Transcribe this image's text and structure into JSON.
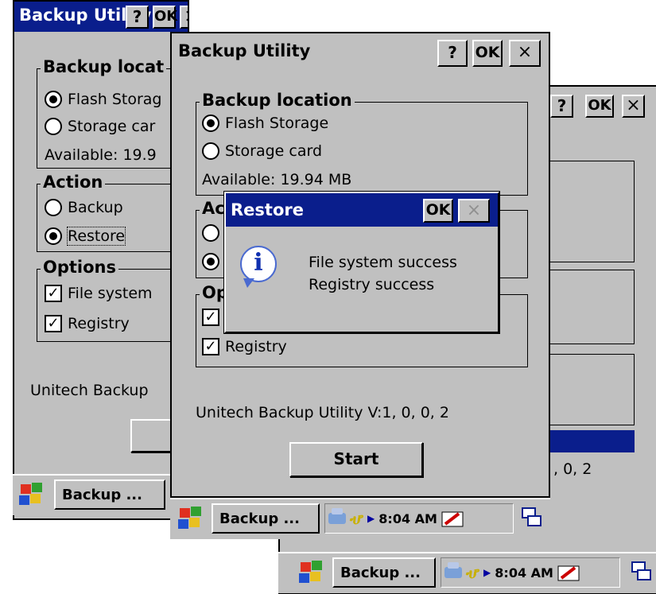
{
  "back_window": {
    "title": "Backup Utility",
    "help_label": "?",
    "ok_label": "OK",
    "close_label": "×",
    "backup_location_legend": "Backup locat",
    "flash_storage": "Flash Storag",
    "storage_card": "Storage car",
    "available": "Available: 19.9",
    "action_legend": "Action",
    "backup": "Backup",
    "restore": "Restore",
    "options_legend": "Options",
    "file_system": "File system",
    "registry": "Registry",
    "version": "Unitech Backup",
    "taskbar_item": "Backup ..."
  },
  "right_window": {
    "help_label": "?",
    "ok_label": "OK",
    "close_label": "×",
    "version_fragment": ", 0, 2",
    "taskbar_item": "Backup ...",
    "clock": "8:04 AM"
  },
  "main_window": {
    "title": "Backup Utility",
    "help_label": "?",
    "ok_label": "OK",
    "close_label": "×",
    "backup_location_legend": "Backup location",
    "flash_storage": "Flash Storage",
    "storage_card": "Storage card",
    "available": "Available: 19.94 MB",
    "action_legend": "Ac",
    "options_legend": "Op",
    "registry": "Registry",
    "version": "Unitech Backup Utility V:1, 0, 0, 2",
    "start_label": "Start",
    "taskbar_item": "Backup ...",
    "clock": "8:04 AM"
  },
  "restore_dialog": {
    "title": "Restore",
    "ok_label": "OK",
    "close_label": "×",
    "line1": "File system success",
    "line2": "Registry success"
  },
  "icons": {
    "info": "information-icon",
    "start_logo": "windows-flag-icon",
    "network": "network-icon",
    "power": "power-plug-icon",
    "input_panel": "input-panel-icon",
    "desktop": "desktop-switch-icon"
  },
  "colors": {
    "titlebar": "#0a1e8c",
    "window_face": "#c0c0c0"
  }
}
